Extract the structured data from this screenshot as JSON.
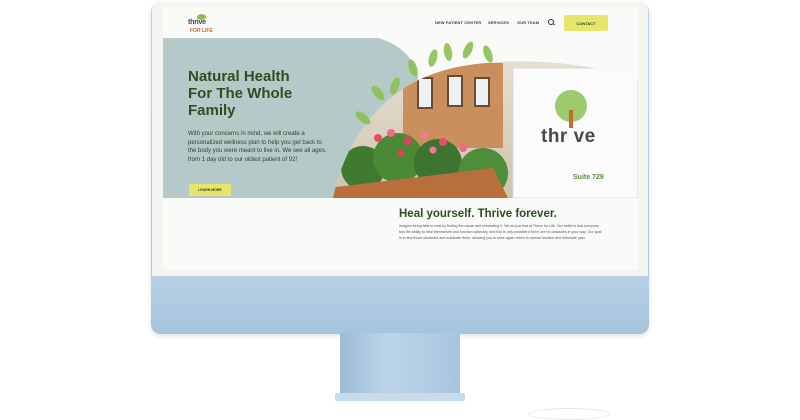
{
  "site": {
    "logo": {
      "wordmark": "thrive",
      "tagline": "FOR LIFE"
    },
    "nav": {
      "links": [
        "NEW PATIENT CENTER",
        "SERVICES",
        "OUR TEAM"
      ],
      "contact_label": "CONTACT"
    },
    "hero": {
      "headline": "Natural Health For The Whole Family",
      "text": "With your concerns in mind, we will create a personalized wellness plan to help you get back to the body you were meant to live in. We see all ages, from 1 day old to our oldest patient of 92!",
      "button_label": "LEARN MORE"
    },
    "photo_sign": {
      "word": "thr ve",
      "suite": "Suite 729"
    },
    "heal": {
      "title": "Heal yourself. Thrive forever.",
      "body": "Imagine being able to heal by finding the cause and eliminating it. We do just that at Thrive for Life. Our belief is that everyone has the ability to heal themselves and function optimally, and this is only possible if there are no obstacles in your way. Our goal is to find those obstacles and eradicate them, allowing you to once again return to normal function and eliminate pain."
    }
  },
  "colors": {
    "accent_yellow": "#e5e66a",
    "headline_green": "#2b4f21",
    "hero_blue_gray": "#b6c9c9",
    "leaf_green": "#8cc152",
    "device_blue": "#b9d2e6"
  }
}
